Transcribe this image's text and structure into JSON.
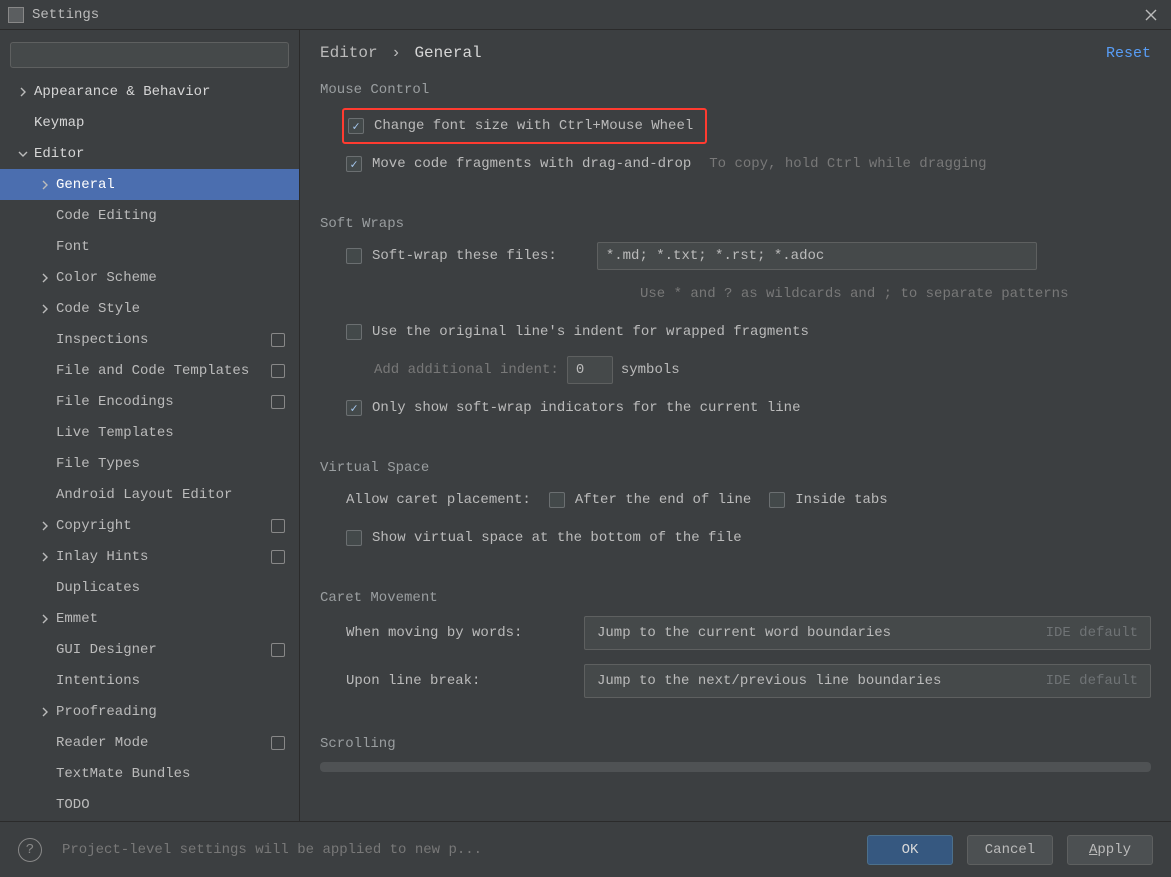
{
  "window": {
    "title": "Settings"
  },
  "search": {
    "placeholder": ""
  },
  "sidebar": [
    {
      "label": "Appearance & Behavior",
      "level": 0,
      "chevron": ">",
      "bold": true
    },
    {
      "label": "Keymap",
      "level": 0,
      "chevron": "",
      "bold": true
    },
    {
      "label": "Editor",
      "level": 0,
      "chevron": "v",
      "bold": true
    },
    {
      "label": "General",
      "level": 1,
      "chevron": ">",
      "selected": true
    },
    {
      "label": "Code Editing",
      "level": 1,
      "chevron": ""
    },
    {
      "label": "Font",
      "level": 1,
      "chevron": ""
    },
    {
      "label": "Color Scheme",
      "level": 1,
      "chevron": ">"
    },
    {
      "label": "Code Style",
      "level": 1,
      "chevron": ">"
    },
    {
      "label": "Inspections",
      "level": 1,
      "chevron": "",
      "badge": true
    },
    {
      "label": "File and Code Templates",
      "level": 1,
      "chevron": "",
      "badge": true
    },
    {
      "label": "File Encodings",
      "level": 1,
      "chevron": "",
      "badge": true
    },
    {
      "label": "Live Templates",
      "level": 1,
      "chevron": ""
    },
    {
      "label": "File Types",
      "level": 1,
      "chevron": ""
    },
    {
      "label": "Android Layout Editor",
      "level": 1,
      "chevron": ""
    },
    {
      "label": "Copyright",
      "level": 1,
      "chevron": ">",
      "badge": true
    },
    {
      "label": "Inlay Hints",
      "level": 1,
      "chevron": ">",
      "badge": true
    },
    {
      "label": "Duplicates",
      "level": 1,
      "chevron": ""
    },
    {
      "label": "Emmet",
      "level": 1,
      "chevron": ">"
    },
    {
      "label": "GUI Designer",
      "level": 1,
      "chevron": "",
      "badge": true
    },
    {
      "label": "Intentions",
      "level": 1,
      "chevron": ""
    },
    {
      "label": "Proofreading",
      "level": 1,
      "chevron": ">"
    },
    {
      "label": "Reader Mode",
      "level": 1,
      "chevron": "",
      "badge": true
    },
    {
      "label": "TextMate Bundles",
      "level": 1,
      "chevron": ""
    },
    {
      "label": "TODO",
      "level": 1,
      "chevron": ""
    }
  ],
  "breadcrumb": {
    "parent": "Editor",
    "sep": "›",
    "current": "General"
  },
  "reset": "Reset",
  "mouse": {
    "heading": "Mouse Control",
    "change_font": "Change font size with Ctrl+Mouse Wheel",
    "drag_drop": "Move code fragments with drag-and-drop",
    "drag_hint": "To copy, hold Ctrl while dragging"
  },
  "softwraps": {
    "heading": "Soft Wraps",
    "wrap_files": "Soft-wrap these files:",
    "pattern_value": "*.md; *.txt; *.rst; *.adoc",
    "pattern_hint": "Use * and ? as wildcards and ; to separate patterns",
    "use_original": "Use the original line's indent for wrapped fragments",
    "add_indent": "Add additional indent:",
    "indent_value": "0",
    "symbols": "symbols",
    "only_show": "Only show soft-wrap indicators for the current line"
  },
  "virtual": {
    "heading": "Virtual Space",
    "caret_label": "Allow caret placement:",
    "after_eol": "After the end of line",
    "inside_tabs": "Inside tabs",
    "show_bottom": "Show virtual space at the bottom of the file"
  },
  "caret_move": {
    "heading": "Caret Movement",
    "by_words": "When moving by words:",
    "by_words_value": "Jump to the current word boundaries",
    "by_words_hint": "IDE default",
    "line_break": "Upon line break:",
    "line_break_value": "Jump to the next/previous line boundaries",
    "line_break_hint": "IDE default"
  },
  "scrolling": {
    "heading": "Scrolling"
  },
  "footer": {
    "note": "Project-level settings will be applied to new p...",
    "ok": "OK",
    "cancel": "Cancel",
    "apply": "Apply"
  }
}
